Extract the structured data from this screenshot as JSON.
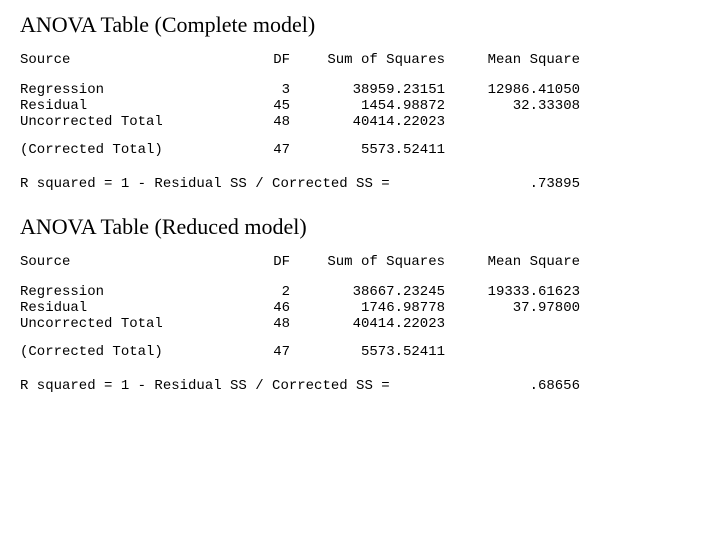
{
  "headers": {
    "source": "Source",
    "df": "DF",
    "ss": "Sum of Squares",
    "ms": "Mean Square"
  },
  "rows": {
    "regression": "Regression",
    "residual": "Residual",
    "uncorrected": "Uncorrected Total",
    "corrected": "(Corrected Total)"
  },
  "rsq_label": "R squared = 1 - Residual SS / Corrected SS =",
  "complete": {
    "title": "ANOVA Table (Complete model)",
    "regression": {
      "df": "3",
      "ss": "38959.23151",
      "ms": "12986.41050"
    },
    "residual": {
      "df": "45",
      "ss": "1454.98872",
      "ms": "32.33308"
    },
    "uncorrected": {
      "df": "48",
      "ss": "40414.22023",
      "ms": ""
    },
    "corrected": {
      "df": "47",
      "ss": "5573.52411",
      "ms": ""
    },
    "rsq": ".73895"
  },
  "reduced": {
    "title": "ANOVA Table (Reduced model)",
    "regression": {
      "df": "2",
      "ss": "38667.23245",
      "ms": "19333.61623"
    },
    "residual": {
      "df": "46",
      "ss": "1746.98778",
      "ms": "37.97800"
    },
    "uncorrected": {
      "df": "48",
      "ss": "40414.22023",
      "ms": ""
    },
    "corrected": {
      "df": "47",
      "ss": "5573.52411",
      "ms": ""
    },
    "rsq": ".68656"
  },
  "chart_data": [
    {
      "type": "table",
      "title": "ANOVA Table (Complete model)",
      "columns": [
        "Source",
        "DF",
        "Sum of Squares",
        "Mean Square"
      ],
      "rows": [
        [
          "Regression",
          3,
          38959.23151,
          12986.4105
        ],
        [
          "Residual",
          45,
          1454.98872,
          32.33308
        ],
        [
          "Uncorrected Total",
          48,
          40414.22023,
          null
        ],
        [
          "(Corrected Total)",
          47,
          5573.52411,
          null
        ]
      ],
      "r_squared": 0.73895
    },
    {
      "type": "table",
      "title": "ANOVA Table (Reduced model)",
      "columns": [
        "Source",
        "DF",
        "Sum of Squares",
        "Mean Square"
      ],
      "rows": [
        [
          "Regression",
          2,
          38667.23245,
          19333.61623
        ],
        [
          "Residual",
          46,
          1746.98778,
          37.978
        ],
        [
          "Uncorrected Total",
          48,
          40414.22023,
          null
        ],
        [
          "(Corrected Total)",
          47,
          5573.52411,
          null
        ]
      ],
      "r_squared": 0.68656
    }
  ]
}
